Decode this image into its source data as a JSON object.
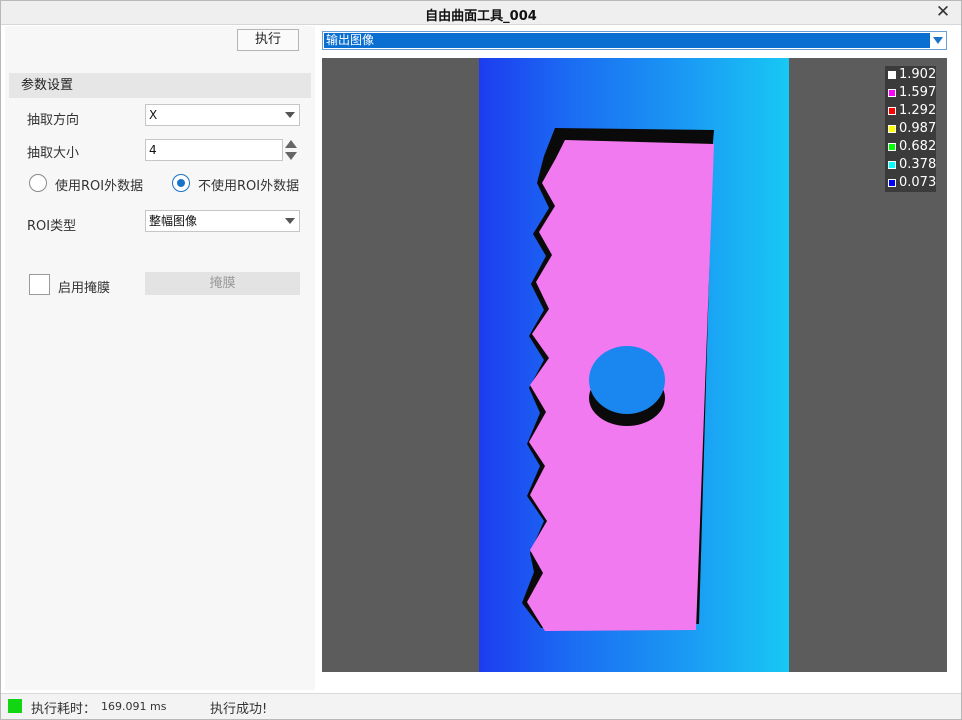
{
  "window": {
    "title": "自由曲面工具_004"
  },
  "toolbar": {
    "execute_label": "执行"
  },
  "params": {
    "section_title": "参数设置",
    "extract_direction": {
      "label": "抽取方向",
      "value": "X"
    },
    "extract_size": {
      "label": "抽取大小",
      "value": "4"
    },
    "roi_options": [
      {
        "label": "使用ROI外数据",
        "checked": false
      },
      {
        "label": "不使用ROI外数据",
        "checked": true
      }
    ],
    "roi_type": {
      "label": "ROI类型",
      "value": "整幅图像"
    },
    "mask": {
      "enable_label": "启用掩膜",
      "enabled": false,
      "button_label": "掩膜"
    }
  },
  "output": {
    "selected": "输出图像"
  },
  "legend": [
    {
      "value": "1.902",
      "color": "#ffffff"
    },
    {
      "value": "1.597",
      "color": "#ff00ff"
    },
    {
      "value": "1.292",
      "color": "#ff0000"
    },
    {
      "value": "0.987",
      "color": "#ffff00"
    },
    {
      "value": "0.682",
      "color": "#00ff00"
    },
    {
      "value": "0.378",
      "color": "#00ffff"
    },
    {
      "value": "0.073",
      "color": "#0000ff"
    }
  ],
  "status": {
    "indicator_color": "#11d611",
    "time_label": "执行耗时：",
    "time_value": "169.091 ms",
    "message": "执行成功!"
  }
}
